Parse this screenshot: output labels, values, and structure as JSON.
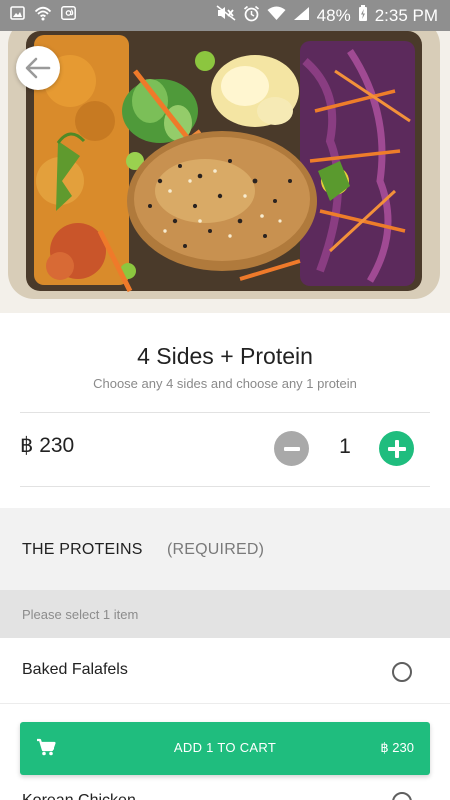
{
  "status_bar": {
    "battery": "48%",
    "time": "2:35 PM",
    "left_icons": [
      "image-icon",
      "wifi-hotspot-icon",
      "at-sign-icon"
    ],
    "right_icons": [
      "mute-icon",
      "alarm-icon",
      "wifi-icon",
      "signal-icon",
      "charging-icon"
    ]
  },
  "hero": {
    "image": "bento-meal-photo",
    "back_icon": "arrow-left-icon"
  },
  "product": {
    "title": "4 Sides + Protein",
    "subtitle": "Choose any 4 sides and choose any 1 protein",
    "price": "฿ 230",
    "quantity": "1"
  },
  "section": {
    "title": "THE PROTEINS",
    "required": "(REQUIRED)",
    "hint": "Please select 1 item",
    "options": [
      {
        "label": "Baked Falafels",
        "selected": false
      },
      {
        "label": "Korean Chicken",
        "selected": false
      }
    ]
  },
  "cart": {
    "label": "ADD 1 TO CART",
    "price": "฿ 230"
  },
  "colors": {
    "accent": "#1fbd7e",
    "status_bar": "#8f8f8f",
    "minus_button": "#a9a9a9",
    "section_background": "#f2f2f2"
  }
}
